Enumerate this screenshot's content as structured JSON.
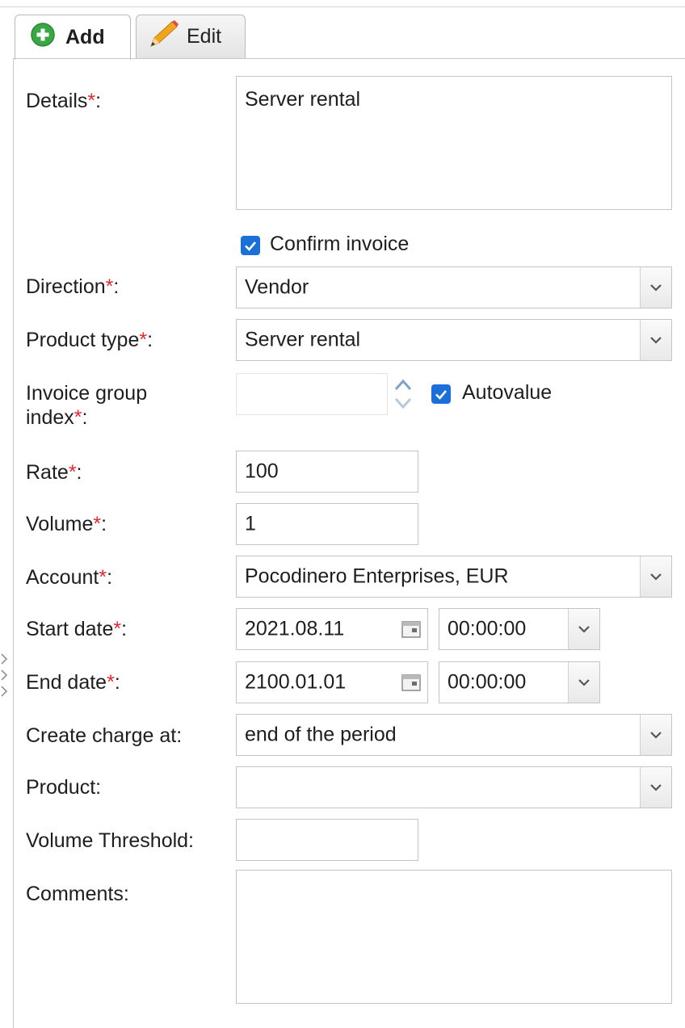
{
  "tabs": {
    "add_label": "Add",
    "edit_label": "Edit"
  },
  "form": {
    "details": {
      "label": "Details",
      "value": "Server rental"
    },
    "confirm_invoice": {
      "label": "Confirm invoice",
      "checked": true
    },
    "direction": {
      "label": "Direction",
      "value": "Vendor"
    },
    "product_type": {
      "label": "Product type",
      "value": "Server rental"
    },
    "invoice_group_index": {
      "label_line1": "Invoice group",
      "label_line2": "index",
      "value": "",
      "autovalue_label": "Autovalue",
      "autovalue_checked": true
    },
    "rate": {
      "label": "Rate",
      "value": "100"
    },
    "volume": {
      "label": "Volume",
      "value": "1"
    },
    "account": {
      "label": "Account",
      "value": "Pocodinero Enterprises, EUR"
    },
    "start_date": {
      "label": "Start date",
      "date": "2021.08.11",
      "time": "00:00:00"
    },
    "end_date": {
      "label": "End date",
      "date": "2100.01.01",
      "time": "00:00:00"
    },
    "create_charge_at": {
      "label": "Create charge at:",
      "value": "end of the period"
    },
    "product": {
      "label": "Product:",
      "value": ""
    },
    "volume_threshold": {
      "label": "Volume Threshold:",
      "value": ""
    },
    "comments": {
      "label": "Comments:",
      "value": ""
    },
    "required_mark": "*",
    "colon": ":"
  },
  "colors": {
    "accent": "#1a6fd8",
    "required": "#e8272e",
    "border": "#c4c4c4",
    "add_icon_green": "#3aa745"
  },
  "icons": [
    "plus-circle-icon",
    "pencil-icon",
    "chevron-down-icon",
    "calendar-icon",
    "spinner-arrows-icon",
    "checkmark-icon"
  ]
}
